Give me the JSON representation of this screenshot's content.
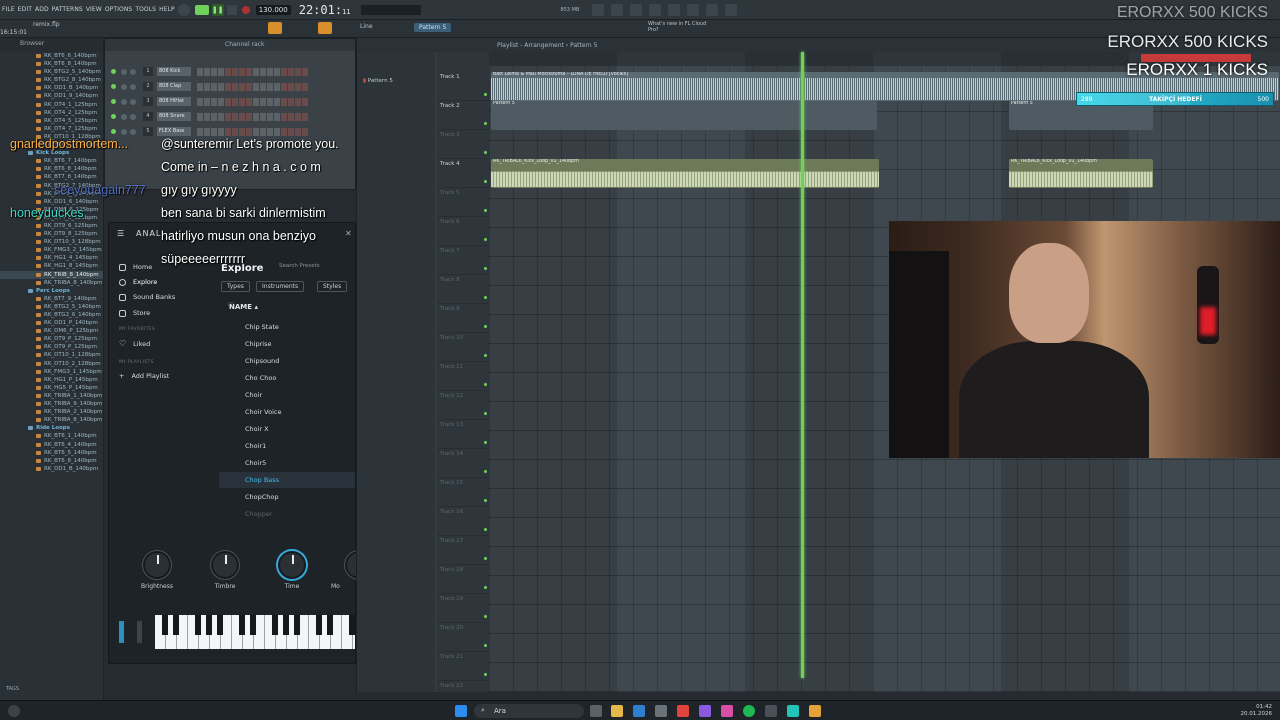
{
  "topbar": {
    "menu": [
      "FILE",
      "EDIT",
      "ADD",
      "PATTERNS",
      "VIEW",
      "OPTIONS",
      "TOOLS",
      "HELP"
    ],
    "tempo": "130.000",
    "clock": "22:01",
    "clock_sub": "11",
    "pattern_selector": "Pattern 5",
    "snap": "Line",
    "news": "What's new in FL Cloud Pro?",
    "cpu": "853 MB"
  },
  "subbar": {
    "file": "remix.flp",
    "time": "16:15:01",
    "playlist_title": "Playlist - Arrangement › Pattern 5"
  },
  "browser": {
    "header": "Browser",
    "rows": [
      {
        "label": "RK_BT6_6_140bpm",
        "type": "file"
      },
      {
        "label": "RK_BT6_8_140bpm",
        "type": "file"
      },
      {
        "label": "RK_BTG2_5_140bpm",
        "type": "file"
      },
      {
        "label": "RK_BTG2_8_140bpm",
        "type": "file"
      },
      {
        "label": "RK_DD1_B_140bpm",
        "type": "file"
      },
      {
        "label": "RK_DD1_9_140bpm",
        "type": "file"
      },
      {
        "label": "RK_DT4_1_125bpm",
        "type": "file"
      },
      {
        "label": "RK_DT4_2_125bpm",
        "type": "file"
      },
      {
        "label": "RK_DT4_5_125bpm",
        "type": "file"
      },
      {
        "label": "RK_DT4_7_125bpm",
        "type": "file"
      },
      {
        "label": "RK_DT10_1_128bpm",
        "type": "file"
      },
      {
        "label": "RK_FMG3_8_140bpm",
        "type": "file"
      },
      {
        "label": "Kick Loops",
        "type": "folder"
      },
      {
        "label": "RK_BT6_7_140bpm",
        "type": "file"
      },
      {
        "label": "RK_BT6_8_140bpm",
        "type": "file"
      },
      {
        "label": "RK_BT7_8_140bpm",
        "type": "file"
      },
      {
        "label": "RK_BTG2_7_140bpm",
        "type": "file"
      },
      {
        "label": "RK_BTG3_1_140bpm",
        "type": "file"
      },
      {
        "label": "RK_DD1_6_140bpm",
        "type": "file"
      },
      {
        "label": "RK_DM6_6_125bpm",
        "type": "file"
      },
      {
        "label": "RK_DT4_3_125bpm",
        "type": "file"
      },
      {
        "label": "RK_DT9_6_125bpm",
        "type": "file"
      },
      {
        "label": "RK_DT9_8_125bpm",
        "type": "file"
      },
      {
        "label": "RK_DT10_3_128bpm",
        "type": "file"
      },
      {
        "label": "RK_FMG3_2_145bpm",
        "type": "file"
      },
      {
        "label": "RK_HG1_4_145bpm",
        "type": "file"
      },
      {
        "label": "RK_HG1_8_145bpm",
        "type": "file"
      },
      {
        "label": "RK_TRIB_8_140bpm",
        "type": "selected"
      },
      {
        "label": "RK_TRIBA_8_140bpm",
        "type": "file"
      },
      {
        "label": "Perc Loops",
        "type": "folder"
      },
      {
        "label": "RK_BT7_9_140bpm",
        "type": "file"
      },
      {
        "label": "RK_BTG2_5_140bpm",
        "type": "file"
      },
      {
        "label": "RK_BTG2_6_140bpm",
        "type": "file"
      },
      {
        "label": "RK_DD1_P_140bpm",
        "type": "file"
      },
      {
        "label": "RK_DM6_P_125bpm",
        "type": "file"
      },
      {
        "label": "RK_DT9_P_125bpm",
        "type": "file"
      },
      {
        "label": "RK_DT9_P_125bpm",
        "type": "file"
      },
      {
        "label": "RK_DT10_1_128bpm",
        "type": "file"
      },
      {
        "label": "RK_DT10_2_128bpm",
        "type": "file"
      },
      {
        "label": "RK_FMG3_1_145bpm",
        "type": "file"
      },
      {
        "label": "RK_HG1_P_145bpm",
        "type": "file"
      },
      {
        "label": "RK_HG5_P_145bpm",
        "type": "file"
      },
      {
        "label": "RK_TRIBA_1_140bpm",
        "type": "file"
      },
      {
        "label": "RK_TRIBA_9_140bpm",
        "type": "file"
      },
      {
        "label": "RK_TRIBA_2_140bpm",
        "type": "file"
      },
      {
        "label": "RK_TRIBA_8_140bpm",
        "type": "file"
      },
      {
        "label": "Ride Loops",
        "type": "folder"
      },
      {
        "label": "RK_BT6_1_140bpm",
        "type": "file"
      },
      {
        "label": "RK_BT6_4_140bpm",
        "type": "file"
      },
      {
        "label": "RK_BT6_5_140bpm",
        "type": "file"
      },
      {
        "label": "RK_BT6_8_140bpm",
        "type": "file"
      },
      {
        "label": "RK_DD1_B_140bpm",
        "type": "file"
      }
    ],
    "footer": "TAGS"
  },
  "rack": {
    "title": "Channel rack",
    "channels": [
      {
        "num": "1",
        "name": "808 Kick"
      },
      {
        "num": "2",
        "name": "808 Clap"
      },
      {
        "num": "3",
        "name": "808 HiHat"
      },
      {
        "num": "4",
        "name": "808 Snare"
      },
      {
        "num": "5",
        "name": "FLEX Bass"
      }
    ]
  },
  "chat": [
    {
      "user": "gnarledpostmortem...",
      "user_color": "#ffb347",
      "message": "@sunteremir Let's promote you."
    },
    {
      "user": "",
      "user_color": "#ffffff",
      "message": "Come in – n e z h n a . c o m"
    },
    {
      "user": "",
      "user_color": "#ffffff",
      "message": "gıy gıy gıyyyy"
    },
    {
      "user": "honeyduckes",
      "user_color": "#3fd9c8",
      "message": "ben sana bi sarki dinlermistim"
    },
    {
      "user": "",
      "user_color": "#ffffff",
      "message": "hatirliyo musun ona benziyo"
    },
    {
      "user": "",
      "user_color": "#ffffff",
      "message": "süpeeeeerrrrrrr"
    }
  ],
  "chat_user_partial": "seeyouagain777",
  "plugin": {
    "brand": "ANAL",
    "nav": [
      "Home",
      "Explore",
      "Sound Banks",
      "Store"
    ],
    "my_favorites": "MY FAVORITES",
    "liked": "Liked",
    "my_playlists": "MY PLAYLISTS",
    "add_playlist": "Add Playlist",
    "explore_title": "Explore",
    "search_placeholder": "Search Presets",
    "filters": [
      "Types",
      "Instruments",
      "Styles"
    ],
    "name_header": "NAME",
    "presets": [
      "Chip State",
      "Chiprise",
      "Chipsound",
      "Cho Choo",
      "Choir",
      "Choir Voice",
      "Choir X",
      "Choir1",
      "Choir5",
      "Chop Bass",
      "ChopChop",
      "Chopper"
    ],
    "selected_preset": "Chop Bass",
    "knobs": [
      "Brightness",
      "Timbre",
      "Time",
      "Mo"
    ]
  },
  "playlist": {
    "pattern_item": "Pattern 5",
    "tracks": [
      "Track 1",
      "Track 2",
      "Track 3",
      "Track 4",
      "Track 5",
      "Track 6",
      "Track 7",
      "Track 8",
      "Track 9",
      "Track 10",
      "Track 11",
      "Track 12",
      "Track 13",
      "Track 14",
      "Track 15",
      "Track 16",
      "Track 17",
      "Track 18",
      "Track 19",
      "Track 20",
      "Track 21",
      "Track 22"
    ],
    "clips": {
      "vocal": "Batt Lelma & Mau Moctezuma – LUNA DE HIELO [vocals]",
      "pattern": "Pattern 5",
      "kick": "RK_TRIBAL6_Kick_Loop_01_140bpm"
    }
  },
  "goals": {
    "line1": "ERORXX  500 KICKS",
    "line2": "ERORXX  500 KICKS",
    "line3": "ERORXX  1 KICKS",
    "bar_left": "289",
    "bar_label": "TAKİPÇİ HEDEFİ",
    "bar_right": "500",
    "progress": 0.578
  },
  "taskbar": {
    "search": "Ara",
    "time": "01:42",
    "date": "20.01.2026"
  },
  "colors": {
    "accent_green": "#6fd15a",
    "selected_preset": "#45b8e8",
    "goal_bar": "#2fd3e8"
  }
}
